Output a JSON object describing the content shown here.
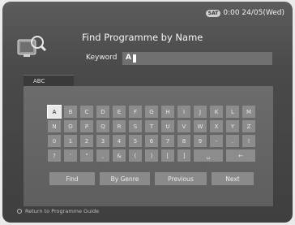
{
  "status": {
    "badge": "SAT",
    "time": "0:00 24/05(Wed)"
  },
  "header": {
    "title": "Find Programme by Name",
    "icon": "tv-search-icon"
  },
  "keyword": {
    "label": "Keyword",
    "value": "A"
  },
  "tab": {
    "label": "ABC"
  },
  "keyboard": {
    "rows": [
      [
        "A",
        "B",
        "C",
        "D",
        "E",
        "F",
        "G",
        "H",
        "I",
        "J",
        "K",
        "L",
        "M"
      ],
      [
        "N",
        "O",
        "P",
        "Q",
        "R",
        "S",
        "T",
        "U",
        "V",
        "W",
        "X",
        "Y",
        "Z"
      ],
      [
        "0",
        "1",
        "2",
        "3",
        "4",
        "5",
        "6",
        "7",
        "8",
        "9",
        "-",
        ".",
        "!"
      ],
      [
        "?",
        "'",
        "\"",
        ",",
        "&",
        "(",
        ")",
        "[",
        "]",
        "␣",
        "←"
      ]
    ],
    "selected": "A"
  },
  "actions": {
    "find": "Find",
    "by_genre": "By Genre",
    "previous": "Previous",
    "next": "Next"
  },
  "footer": {
    "text": "Return to Programme Guide"
  }
}
